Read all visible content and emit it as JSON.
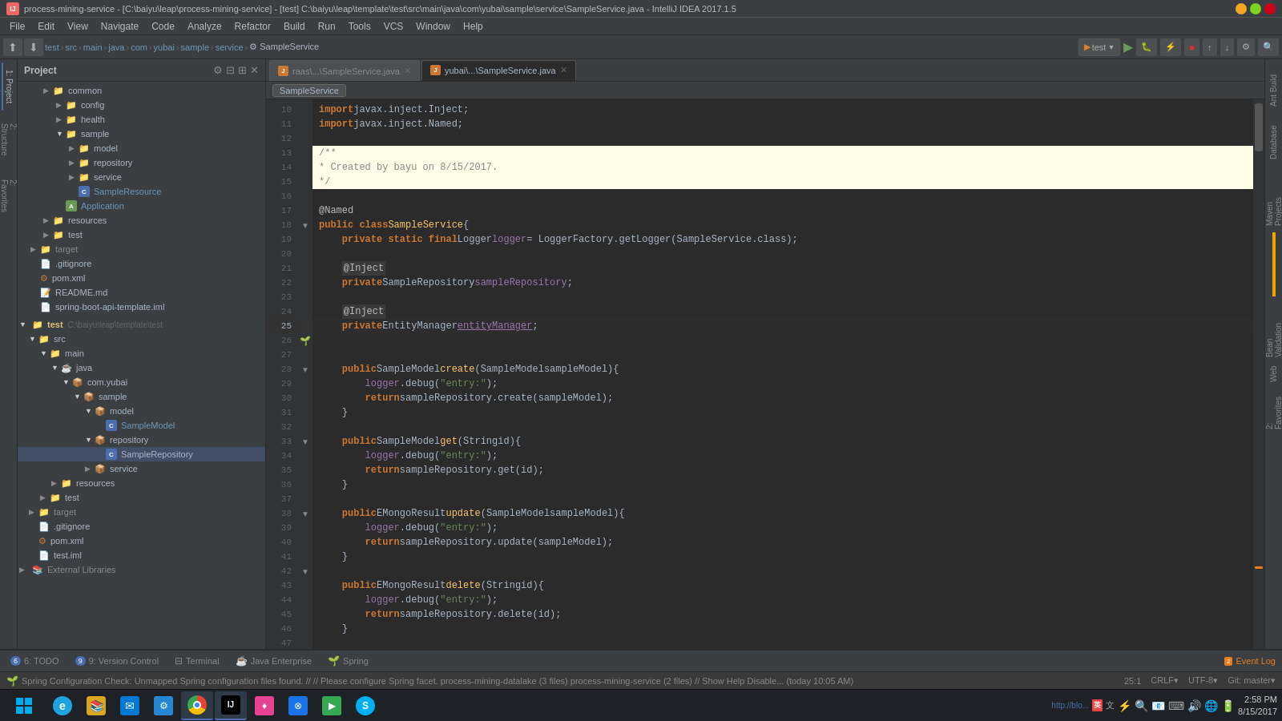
{
  "titlebar": {
    "title": "process-mining-service - [C:\\baiyu\\leap\\process-mining-service] - [test] C:\\baiyu\\leap\\template\\test\\src\\main\\java\\com\\yubai\\sample\\service\\SampleService.java - IntelliJ IDEA 2017.1.5",
    "icon_label": "IJ"
  },
  "menubar": {
    "items": [
      "File",
      "Edit",
      "View",
      "Navigate",
      "Code",
      "Analyze",
      "Refactor",
      "Build",
      "Run",
      "Tools",
      "VCS",
      "Window",
      "Help"
    ]
  },
  "navbar": {
    "run_config": "test",
    "breadcrumb": [
      "test",
      "src",
      "main",
      "java",
      "com",
      "yubai",
      "sample",
      "service",
      "SampleService"
    ]
  },
  "project": {
    "title": "Project",
    "tree": [
      {
        "id": "common",
        "label": "common",
        "type": "folder",
        "indent": 2,
        "expanded": false
      },
      {
        "id": "config",
        "label": "config",
        "type": "folder",
        "indent": 3,
        "expanded": false
      },
      {
        "id": "health",
        "label": "health",
        "type": "folder",
        "indent": 3,
        "expanded": false
      },
      {
        "id": "sample",
        "label": "sample",
        "type": "folder",
        "indent": 3,
        "expanded": true
      },
      {
        "id": "model",
        "label": "model",
        "type": "folder",
        "indent": 4,
        "expanded": false
      },
      {
        "id": "repository",
        "label": "repository",
        "type": "folder",
        "indent": 4,
        "expanded": false
      },
      {
        "id": "service",
        "label": "service",
        "type": "folder",
        "indent": 4,
        "expanded": false
      },
      {
        "id": "SampleResource",
        "label": "SampleResource",
        "type": "class-c",
        "indent": 4
      },
      {
        "id": "Application",
        "label": "Application",
        "type": "class-a",
        "indent": 3
      },
      {
        "id": "resources",
        "label": "resources",
        "type": "folder",
        "indent": 2,
        "expanded": false
      },
      {
        "id": "test",
        "label": "test",
        "type": "folder",
        "indent": 2,
        "expanded": true
      },
      {
        "id": "target",
        "label": "target",
        "type": "folder",
        "indent": 1,
        "expanded": false
      },
      {
        "id": "gitignore",
        "label": ".gitignore",
        "type": "file",
        "indent": 1
      },
      {
        "id": "pom",
        "label": "pom.xml",
        "type": "xml",
        "indent": 1
      },
      {
        "id": "readme",
        "label": "README.md",
        "type": "file",
        "indent": 1
      },
      {
        "id": "spring-boot-api",
        "label": "spring-boot-api-template.iml",
        "type": "iml",
        "indent": 1
      },
      {
        "id": "test-root",
        "label": "test",
        "type": "folder-test",
        "indent": 0,
        "expanded": true
      },
      {
        "id": "test-path",
        "label": "C:\\baiyu\\leap\\template\\test",
        "type": "path",
        "indent": 0
      },
      {
        "id": "src-test",
        "label": "src",
        "type": "folder",
        "indent": 1,
        "expanded": true
      },
      {
        "id": "main-test",
        "label": "main",
        "type": "folder",
        "indent": 2,
        "expanded": true
      },
      {
        "id": "java-test",
        "label": "java",
        "type": "folder",
        "indent": 3,
        "expanded": true
      },
      {
        "id": "com-yubai",
        "label": "com.yubai",
        "type": "package",
        "indent": 4,
        "expanded": true
      },
      {
        "id": "sample-test",
        "label": "sample",
        "type": "package",
        "indent": 5,
        "expanded": true
      },
      {
        "id": "model-test",
        "label": "model",
        "type": "package",
        "indent": 6,
        "expanded": true
      },
      {
        "id": "SampleModel",
        "label": "SampleModel",
        "type": "class-c",
        "indent": 7
      },
      {
        "id": "repository-test",
        "label": "repository",
        "type": "package",
        "indent": 6,
        "expanded": true
      },
      {
        "id": "SampleRepository",
        "label": "SampleRepository",
        "type": "class-c",
        "indent": 7,
        "selected": true
      },
      {
        "id": "service-test",
        "label": "service",
        "type": "package",
        "indent": 6,
        "expanded": false
      },
      {
        "id": "resources-test",
        "label": "resources",
        "type": "folder",
        "indent": 3,
        "expanded": false
      },
      {
        "id": "test-dir",
        "label": "test",
        "type": "folder",
        "indent": 2,
        "expanded": false
      },
      {
        "id": "target-test",
        "label": "target",
        "type": "folder",
        "indent": 1,
        "expanded": false
      },
      {
        "id": "gitignore2",
        "label": ".gitignore",
        "type": "file",
        "indent": 1
      },
      {
        "id": "pom2",
        "label": "pom.xml",
        "type": "xml",
        "indent": 1
      },
      {
        "id": "test-iml",
        "label": "test.iml",
        "type": "iml",
        "indent": 1
      },
      {
        "id": "ext-libs",
        "label": "External Libraries",
        "type": "ext",
        "indent": 0
      }
    ]
  },
  "editor": {
    "tabs": [
      {
        "id": "raas-tab",
        "label": "raas\\...\\SampleService.java",
        "active": false
      },
      {
        "id": "yubai-tab",
        "label": "yubai\\...\\SampleService.java",
        "active": true
      }
    ],
    "filename_chip": "SampleService",
    "code_lines": [
      {
        "num": 10,
        "content_html": "<span class='kw'>import</span> javax.inject.Inject;"
      },
      {
        "num": 11,
        "content_html": "<span class='kw'>import</span> javax.inject.Named;"
      },
      {
        "num": 12,
        "content_html": ""
      },
      {
        "num": 13,
        "content_html": "<span class='comment'>/**</span>",
        "highlight": true
      },
      {
        "num": 14,
        "content_html": "<span class='comment'> * Created by bayu on 8/15/2017.</span>",
        "highlight": true
      },
      {
        "num": 15,
        "content_html": "<span class='comment'> */</span>",
        "highlight": true
      },
      {
        "num": 16,
        "content_html": ""
      },
      {
        "num": 17,
        "content_html": "<span class='annotation'>@Named</span>"
      },
      {
        "num": 18,
        "content_html": "<span class='kw'>public class</span> <span class='class-name'>SampleService</span> {"
      },
      {
        "num": 19,
        "content_html": "    <span class='kw'>private static final</span> <span class='type'>Logger</span> <span class='static-field'>logger</span> = LoggerFactory.getLogger(SampleService.class);"
      },
      {
        "num": 20,
        "content_html": ""
      },
      {
        "num": 21,
        "content_html": "    <span class='annotation'>@Inject</span>"
      },
      {
        "num": 22,
        "content_html": "    <span class='kw'>private</span> <span class='type'>SampleRepository</span> <span class='local-var'>sampleRepository</span>;"
      },
      {
        "num": 23,
        "content_html": ""
      },
      {
        "num": 24,
        "content_html": "    <span class='annotation'>@Inject</span>"
      },
      {
        "num": 25,
        "content_html": "    <span class='kw'>private</span> <span class='type'>EntityManager</span> <span class='local-var'>entityManager</span>;"
      },
      {
        "num": 26,
        "content_html": ""
      },
      {
        "num": 27,
        "content_html": ""
      },
      {
        "num": 28,
        "content_html": "    <span class='kw'>public</span> <span class='type'>SampleModel</span> <span class='method'>create</span>(<span class='type'>SampleModel</span> sampleModel){"
      },
      {
        "num": 29,
        "content_html": "        <span class='local-var'>logger</span>.debug(<span class='string'>\"entry:\"</span>);"
      },
      {
        "num": 30,
        "content_html": "        <span class='kw'>return</span> sampleRepository.create(sampleModel);"
      },
      {
        "num": 31,
        "content_html": "    }"
      },
      {
        "num": 32,
        "content_html": ""
      },
      {
        "num": 33,
        "content_html": "    <span class='kw'>public</span> <span class='type'>SampleModel</span> <span class='method'>get</span>(<span class='type'>String</span> id){"
      },
      {
        "num": 34,
        "content_html": "        <span class='local-var'>logger</span>.debug(<span class='string'>\"entry:\"</span>);"
      },
      {
        "num": 35,
        "content_html": "        <span class='kw'>return</span> sampleRepository.get(id);"
      },
      {
        "num": 36,
        "content_html": "    }"
      },
      {
        "num": 37,
        "content_html": ""
      },
      {
        "num": 38,
        "content_html": "    <span class='kw'>public</span> <span class='type'>EMongoResult</span> <span class='method'>update</span>(<span class='type'>SampleModel</span> sampleModel){"
      },
      {
        "num": 39,
        "content_html": "        <span class='local-var'>logger</span>.debug(<span class='string'>\"entry:\"</span>);"
      },
      {
        "num": 40,
        "content_html": "        <span class='kw'>return</span> sampleRepository.update(sampleModel);"
      },
      {
        "num": 41,
        "content_html": "    }"
      },
      {
        "num": 42,
        "content_html": ""
      },
      {
        "num": 43,
        "content_html": "    <span class='kw'>public</span> <span class='type'>EMongoResult</span> <span class='method'>delete</span>(<span class='type'>String</span> id){"
      },
      {
        "num": 44,
        "content_html": "        <span class='local-var'>logger</span>.debug(<span class='string'>\"entry:\"</span>);"
      },
      {
        "num": 45,
        "content_html": "        <span class='kw'>return</span> sampleRepository.delete(id);"
      },
      {
        "num": 46,
        "content_html": "    }"
      },
      {
        "num": 47,
        "content_html": ""
      },
      {
        "num": 48,
        "content_html": "    }"
      }
    ]
  },
  "bottom_tabs": [
    {
      "id": "todo",
      "label": "6: TODO",
      "badge": "6"
    },
    {
      "id": "vc",
      "label": "9: Version Control",
      "badge": "9"
    },
    {
      "id": "terminal",
      "label": "Terminal"
    },
    {
      "id": "java-enterprise",
      "label": "Java Enterprise"
    },
    {
      "id": "spring",
      "label": "Spring",
      "icon": "spring"
    }
  ],
  "right_panels": [
    {
      "id": "ant-build",
      "label": "Ant Build"
    },
    {
      "id": "database",
      "label": "Database"
    },
    {
      "id": "maven",
      "label": "Maven Projects"
    },
    {
      "id": "bean-validation",
      "label": "Bean Validation"
    },
    {
      "id": "web",
      "label": "Web"
    },
    {
      "id": "favorites",
      "label": "2: Favorites"
    }
  ],
  "status_bar": {
    "spring_check": "Spring Configuration Check: Unmapped Spring configuration files found. // // Please configure Spring facet. process-mining-datalake (3 files) process-mining-service (2 files) // Show Help Disable... (today 10:05 AM)",
    "event_log": "Event Log",
    "cursor_pos": "25:1",
    "line_sep": "CRLF▾",
    "encoding": "UTF-8▾",
    "git_branch": "Git: master▾"
  },
  "taskbar": {
    "time": "2:58 PM",
    "date": "8/15/2017",
    "url_hint": "http://blo..."
  }
}
